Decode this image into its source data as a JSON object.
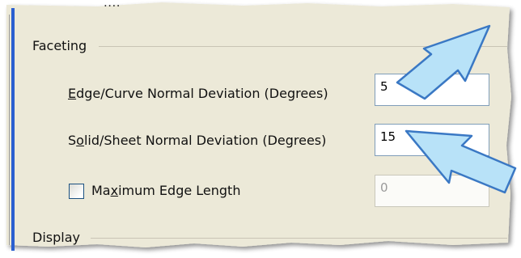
{
  "cut_top_text": "....",
  "faceting": {
    "group_label": "Faceting",
    "edge_curve": {
      "label_pre": "",
      "label_ul": "E",
      "label_post": "dge/Curve Normal Deviation (Degrees)",
      "value": "5"
    },
    "solid_sheet": {
      "label_pre": "S",
      "label_ul": "o",
      "label_post": "lid/Sheet Normal Deviation (Degrees)",
      "value": "15"
    },
    "max_edge": {
      "label_pre": "Ma",
      "label_ul": "x",
      "label_post": "imum Edge Length",
      "value": "0",
      "checked": false
    }
  },
  "display": {
    "group_label": "Display"
  },
  "colors": {
    "accent_blue": "#2a5fd0",
    "arrow_fill": "#b8e2f8",
    "arrow_stroke": "#3a78c4"
  }
}
